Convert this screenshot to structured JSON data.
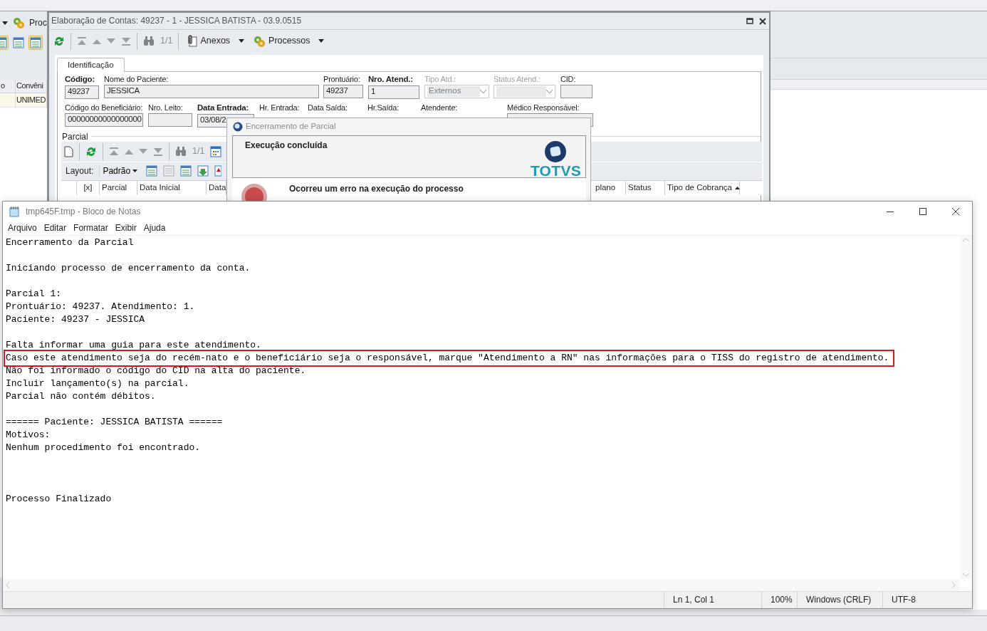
{
  "background_app": {
    "toolbar_label": "Proc",
    "columns": [
      "o",
      "Convêni"
    ],
    "rows": [
      {
        "cells": [
          "",
          "UNIMED"
        ]
      }
    ]
  },
  "account_window": {
    "title": "Elaboração de Contas: 49237 - 1 - JESSICA BATISTA - 03.9.0515",
    "toolbar": {
      "page": "1/1",
      "menus": [
        {
          "label": "Anexos",
          "kind": "attach"
        },
        {
          "label": "Processos",
          "kind": "process"
        }
      ]
    },
    "tabs": [
      {
        "label": "Identificação",
        "selected": true
      }
    ],
    "fields_row_1": [
      {
        "label": "Código:",
        "required": true,
        "disabled": false,
        "kind": "text",
        "value": "49237"
      },
      {
        "label": "Nome do Paciente:",
        "required": false,
        "disabled": false,
        "kind": "text",
        "value": "JESSICA"
      },
      {
        "label": "Prontuário:",
        "required": false,
        "disabled": false,
        "kind": "text",
        "value": "49237"
      },
      {
        "label": "Nro. Atend.:",
        "required": true,
        "disabled": false,
        "kind": "text",
        "value": "1"
      },
      {
        "label": "Tipo Atd.:",
        "required": false,
        "disabled": true,
        "kind": "select",
        "value": "Externos"
      },
      {
        "label": "Status Atend.:",
        "required": false,
        "disabled": true,
        "kind": "select"
      },
      {
        "label": "CID:",
        "required": false,
        "disabled": false,
        "kind": "text"
      }
    ],
    "fields_row_2": [
      {
        "label": "Código do Beneficiário:",
        "required": false,
        "disabled": false,
        "kind": "text",
        "value": "00000000000000000"
      },
      {
        "label": "Nro. Leito:",
        "required": false,
        "disabled": false,
        "kind": "text"
      },
      {
        "label": "Data Entrada:",
        "required": true,
        "disabled": false,
        "kind": "text",
        "value": "03/08/2"
      },
      {
        "label": "Hr. Entrada:",
        "required": false,
        "disabled": false,
        "kind": "label"
      },
      {
        "label": "Data Saída:",
        "required": false,
        "disabled": false,
        "kind": "label"
      },
      {
        "label": "Hr.Saída:",
        "required": false,
        "disabled": false,
        "kind": "label"
      },
      {
        "label": "Atendente:",
        "required": false,
        "disabled": false,
        "kind": "label"
      },
      {
        "label": "Médico Responsável:",
        "required": false,
        "disabled": false,
        "kind": "text"
      }
    ],
    "section": {
      "label": "Parcial",
      "page": "1/1",
      "layout_label": "Layout:",
      "layout_value": "Padrão",
      "columns": [
        {
          "label": "[x]",
          "sorted": false
        },
        {
          "label": "Parcial",
          "sorted": false
        },
        {
          "label": "Data Inicial",
          "sorted": false
        },
        {
          "label": "Data"
        },
        {
          "label": "plano",
          "sorted": false
        },
        {
          "label": "Status",
          "sorted": false
        },
        {
          "label": "Tipo de Cobrança",
          "sorted": true
        }
      ]
    }
  },
  "dialog": {
    "title": "Encerramento de Parcial",
    "heading": "Execução concluída",
    "logo_text": "TOTVS",
    "message": "Ocorreu um erro na execução do processo"
  },
  "notepad": {
    "title": "tmp645F.tmp - Bloco de Notas",
    "menu": [
      "Arquivo",
      "Editar",
      "Formatar",
      "Exibir",
      "Ajuda"
    ],
    "paragraphs": [
      {
        "kind": "text",
        "lines": [
          {
            "text": "Encerramento da Parcial",
            "highlighted": false
          }
        ]
      },
      {
        "kind": "text",
        "lines": [
          {
            "text": "Iniciando processo de encerramento da conta.",
            "highlighted": false
          }
        ]
      },
      {
        "kind": "text",
        "lines": [
          {
            "text": "Parcial 1:",
            "highlighted": false
          },
          {
            "text": "Prontuário: 49237. Atendimento: 1.",
            "highlighted": false
          },
          {
            "text": "Paciente: 49237 - JESSICA",
            "highlighted": false
          }
        ]
      },
      {
        "kind": "text",
        "lines": [
          {
            "text": "Falta informar uma guia para este atendimento.",
            "highlighted": false
          },
          {
            "text": "Caso este atendimento seja do recém-nato e o beneficiário seja o responsável, marque \"Atendimento a RN\" nas informações para o TISS do registro de atendimento.",
            "highlighted": true
          },
          {
            "text": "Não foi informado o código do CID na alta do paciente.",
            "highlighted": false
          },
          {
            "text": "Incluir lançamento(s) na parcial.",
            "highlighted": false
          },
          {
            "text": "Parcial não contém débitos.",
            "highlighted": false
          }
        ]
      },
      {
        "kind": "text",
        "lines": [
          {
            "text": "====== Paciente: JESSICA BATISTA ======",
            "highlighted": false
          },
          {
            "text": "Motivos:",
            "highlighted": false
          },
          {
            "text": "Nenhum procedimento foi encontrado.",
            "highlighted": false
          }
        ]
      },
      {
        "kind": "closing",
        "lines": [
          {
            "text": "Processo Finalizado",
            "highlighted": false
          }
        ]
      }
    ],
    "status_bar": [
      "Ln 1, Col 1",
      "100%",
      "Windows (CRLF)",
      "UTF-8"
    ]
  }
}
